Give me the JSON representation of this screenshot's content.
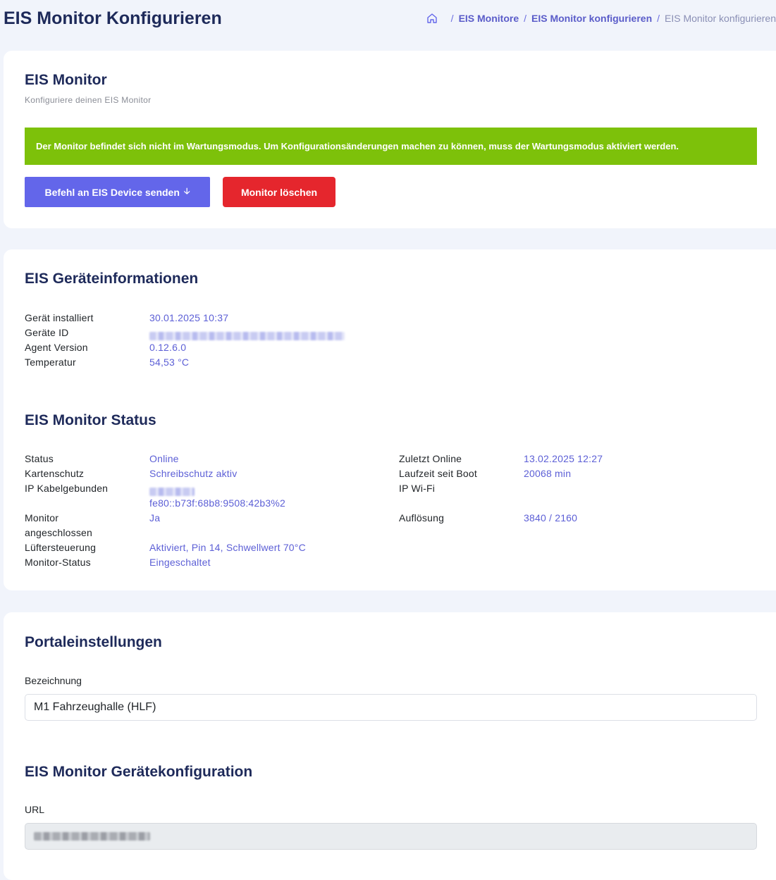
{
  "page": {
    "title": "EIS Monitor Konfigurieren"
  },
  "breadcrumb": {
    "home_icon": "home-icon",
    "items": [
      "EIS Monitore",
      "EIS Monitor konfigurieren"
    ],
    "current": "EIS Monitor konfigurieren",
    "separator": "/"
  },
  "monitor_card": {
    "title": "EIS Monitor",
    "subtitle": "Konfiguriere deinen EIS Monitor",
    "alert": "Der Monitor befindet sich nicht im Wartungsmodus. Um Konfigurationsänderungen machen zu können, muss der Wartungsmodus aktiviert werden.",
    "send_command_label": "Befehl an EIS Device senden",
    "send_command_icon": "arrow-down-icon",
    "delete_label": "Monitor löschen"
  },
  "device_info": {
    "title": "EIS Geräteinformationen",
    "rows": [
      {
        "label": "Gerät installiert",
        "value": "30.01.2025 10:37"
      },
      {
        "label": "Geräte ID",
        "value": ""
      },
      {
        "label": "Agent Version",
        "value": "0.12.6.0"
      },
      {
        "label": "Temperatur",
        "value": "54,53 °C"
      }
    ]
  },
  "monitor_status": {
    "title": "EIS Monitor Status",
    "left": [
      {
        "label": "Status",
        "value": "Online"
      },
      {
        "label": "Kartenschutz",
        "value": "Schreibschutz aktiv"
      },
      {
        "label": "IP Kabelgebunden",
        "value": "",
        "value2": "fe80::b73f:68b8:9508:42b3%2"
      },
      {
        "label": "Monitor",
        "label2": "angeschlossen",
        "value": "Ja"
      },
      {
        "label": "Lüftersteuerung",
        "value": "Aktiviert, Pin 14, Schwellwert 70°C"
      },
      {
        "label": "Monitor-Status",
        "value": "Eingeschaltet"
      }
    ],
    "right": [
      {
        "label": "Zuletzt Online",
        "value": "13.02.2025 12:27"
      },
      {
        "label": "Laufzeit seit Boot",
        "value": "20068 min"
      },
      {
        "label": "IP Wi-Fi",
        "value": ""
      },
      {
        "label": "Auflösung",
        "value": "3840 / 2160"
      }
    ]
  },
  "portal_settings": {
    "title": "Portaleinstellungen",
    "name_label": "Bezeichnung",
    "name_value": "M1 Fahrzeughalle (HLF)"
  },
  "device_config": {
    "title": "EIS Monitor Gerätekonfiguration",
    "url_label": "URL",
    "url_value": ""
  },
  "colors": {
    "accent": "#6366ea",
    "danger": "#e5262d",
    "alert_success": "#7dc10a",
    "link_value": "#5c5fd6",
    "heading": "#1e2a5a"
  }
}
